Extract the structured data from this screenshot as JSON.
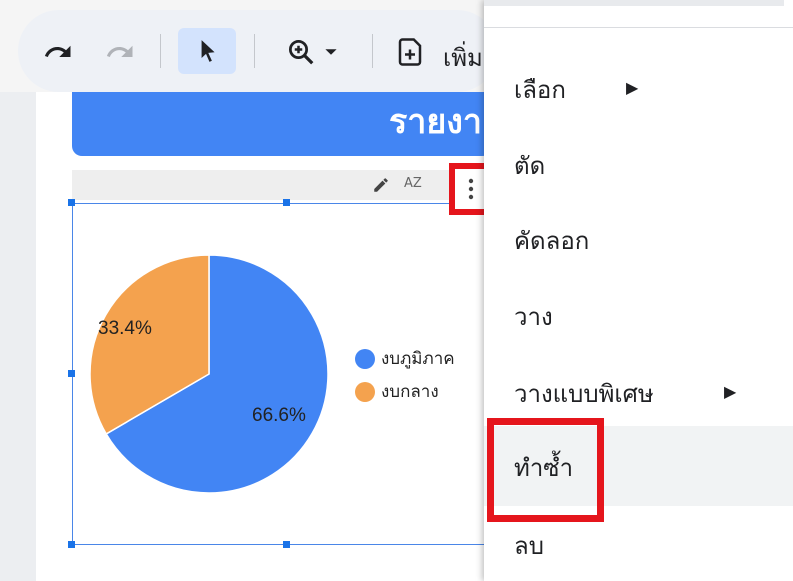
{
  "toolbar": {
    "add_label": "เพิ่ม",
    "icons": [
      "undo-icon",
      "redo-icon",
      "select-pointer-icon",
      "zoom-icon",
      "chevron-down-icon",
      "add-page-icon"
    ]
  },
  "report": {
    "title_fragment": "รายงา"
  },
  "chart": {
    "toolbar_icons": [
      "pencil-icon",
      "sort-az-icon",
      "more-vert-icon"
    ],
    "sort_label": "AZ"
  },
  "chart_data": {
    "type": "pie",
    "title": "",
    "slices": [
      {
        "name": "งบภูมิภาค",
        "value": 66.6,
        "label": "66.6%",
        "color": "#4285f4"
      },
      {
        "name": "งบกลาง",
        "value": 33.4,
        "label": "33.4%",
        "color": "#f4a24e"
      }
    ],
    "legend_position": "right"
  },
  "menu": {
    "items": [
      {
        "label": "เลือก",
        "submenu": true
      },
      {
        "label": "ตัด",
        "submenu": false
      },
      {
        "label": "คัดลอก",
        "submenu": false
      },
      {
        "label": "วาง",
        "submenu": false
      },
      {
        "label": "วางแบบพิเศษ",
        "submenu": true
      },
      {
        "label": "ทำซ้ำ",
        "submenu": false,
        "highlighted": true
      },
      {
        "label": "ลบ",
        "submenu": false
      }
    ]
  },
  "colors": {
    "accent": "#4285f4",
    "highlight_box": "#e5151c",
    "pie_orange": "#f4a24e"
  }
}
